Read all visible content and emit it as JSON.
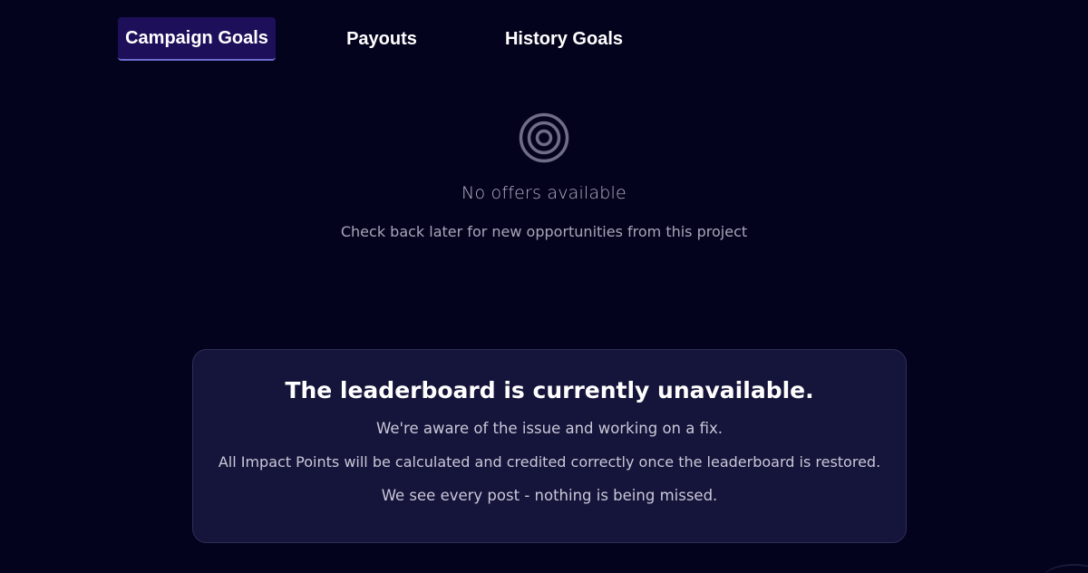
{
  "tabs": [
    {
      "label": "Campaign Goals",
      "active": true
    },
    {
      "label": "Payouts",
      "active": false
    },
    {
      "label": "History Goals",
      "active": false
    }
  ],
  "empty_state": {
    "icon": "target-icon",
    "title": "No offers available",
    "subtitle": "Check back later for new opportunities from this project"
  },
  "leaderboard_notice": {
    "title": "The leaderboard is currently unavailable.",
    "lines": [
      "We're aware of the issue and working on a fix.",
      "All Impact Points will be calculated and credited correctly once the leaderboard is restored.",
      "We see every post - nothing is being missed."
    ]
  },
  "colors": {
    "background": "#04031e",
    "active_tab": "#1d0f5a",
    "card_background": "#15143a",
    "muted_text": "#b5b3c4"
  }
}
